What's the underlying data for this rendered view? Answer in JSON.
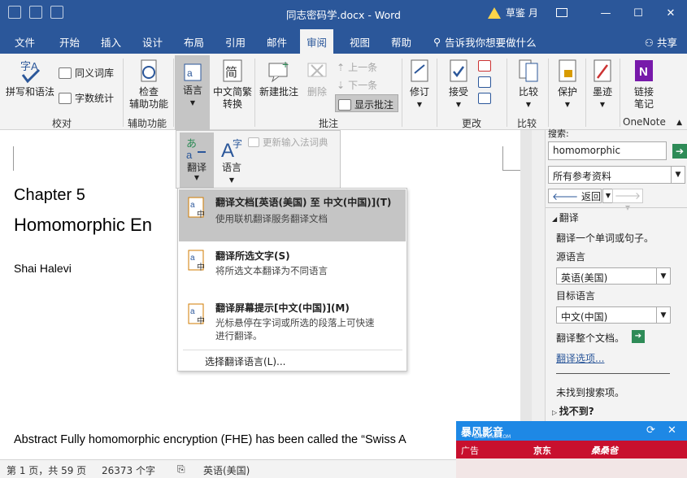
{
  "app": {
    "doc_title": "同志密码学.docx  -  Word",
    "user": "草鉴 月"
  },
  "tabs": [
    "文件",
    "开始",
    "插入",
    "设计",
    "布局",
    "引用",
    "邮件",
    "审阅",
    "视图",
    "帮助"
  ],
  "active_tab": "审阅",
  "tellme": "告诉我你想要做什么",
  "share": "共享",
  "ribbon": {
    "spelling": "拼写和语法",
    "thesaurus": "同义词库",
    "wordcount": "字数统计",
    "check_access_1": "检查",
    "check_access_2": "辅助功能",
    "language": "语言",
    "tradsimp_1": "中文简繁",
    "tradsimp_2": "转换",
    "new_comment": "新建批注",
    "delete": "删除",
    "prev": "上一条",
    "next": "下一条",
    "show_comments": "显示批注",
    "track": "修订",
    "accept": "接受",
    "compare": "比较",
    "protect": "保护",
    "ink": "墨迹",
    "linked_1": "链接",
    "linked_2": "笔记",
    "groups": {
      "proofing": "校对",
      "accessibility": "辅助功能",
      "comments": "批注",
      "changes": "更改",
      "compare": "比较",
      "onenote": "OneNote"
    }
  },
  "lang_dropdown": {
    "translate": "翻译",
    "language": "语言",
    "update_ime": "更新输入法词典"
  },
  "translate_menu": {
    "item1_title": "翻译文档[英语(美国) 至 中文(中国)](T)",
    "item1_desc": "使用联机翻译服务翻译文档",
    "item2_title": "翻译所选文字(S)",
    "item2_desc": "将所选文本翻译为不同语言",
    "item3_title": "翻译屏幕提示[中文(中国)](M)",
    "item3_desc_1": "光标悬停在字词或所选的段落上可快速",
    "item3_desc_2": "进行翻译。",
    "choose_lang": "选择翻译语言(L)..."
  },
  "document": {
    "chapter": "Chapter 5",
    "heading": "Homomorphic En",
    "author": "Shai Halevi",
    "abstract": "Abstract Fully homomorphic encryption (FHE) has been called the “Swiss A"
  },
  "pane": {
    "search_label": "搜索:",
    "search_value": "homomorphic",
    "scope": "所有参考资料",
    "back": "返回",
    "section": "翻译",
    "translate_hint": "翻译一个单词或句子。",
    "source_label": "源语言",
    "source_value": "英语(美国)",
    "target_label": "目标语言",
    "target_value": "中文(中国)",
    "translate_doc": "翻译整个文档。",
    "options_link": "翻译选项...",
    "not_found": "未找到搜索项。",
    "cant_find": "找不到?"
  },
  "status": {
    "page": "第 1 页，共 59 页",
    "words": "26373 个字",
    "lang": "英语(美国)"
  },
  "ad": {
    "logo": "暴风影音",
    "logo_sub": "BAOFENG.COM",
    "label": "广告",
    "brand1": "京东",
    "brand2": "桑桑爸"
  },
  "colors": {
    "accent": "#2b579a",
    "ad_blue": "#1e88e5",
    "ad_red": "#c8102e"
  }
}
